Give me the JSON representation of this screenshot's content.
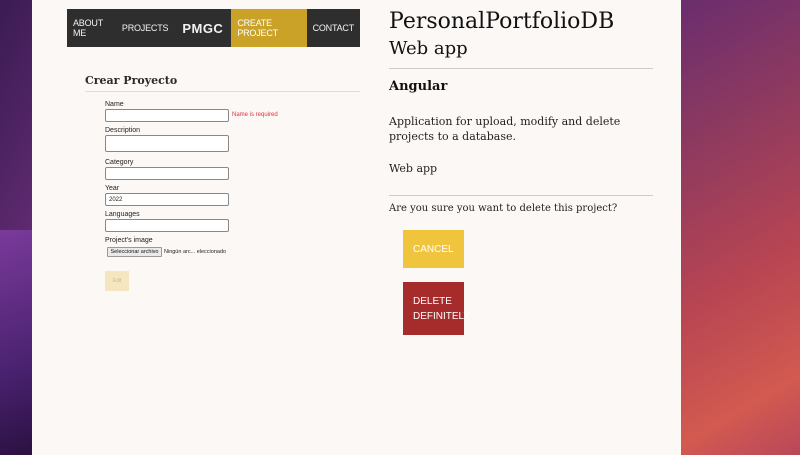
{
  "navbar": {
    "items": [
      {
        "label": "About me"
      },
      {
        "label": "Projects"
      },
      {
        "label": "PMGC"
      },
      {
        "label": "Create project"
      },
      {
        "label": "Contact"
      }
    ]
  },
  "form": {
    "title": "Crear Proyecto",
    "name_label": "Name",
    "name_value": "",
    "name_error": "Name is required",
    "description_label": "Description",
    "description_value": "",
    "category_label": "Category",
    "category_value": "",
    "year_label": "Year",
    "year_value": "2022",
    "languages_label": "Languages",
    "languages_value": "",
    "image_label": "Project's image",
    "file_button_label": "Seleccionar archivo",
    "file_status": "Ningún arc... eleccionado",
    "submit_label": "Edit"
  },
  "project": {
    "title": "PersonalPortfolioDB",
    "subtitle": "Web app",
    "technology": "Angular",
    "description": "Application for upload, modify and delete projects to a database.",
    "category": "Web app",
    "delete_question": "Are you sure you want to delete this project?",
    "cancel_label": "Cancel",
    "delete_label_line1": "Delete",
    "delete_label_line2": "definitely"
  },
  "colors": {
    "accent_gold": "#c9a227",
    "cancel_yellow": "#f0c43c",
    "delete_red": "#a62b2b",
    "error_red": "#e0303a"
  }
}
